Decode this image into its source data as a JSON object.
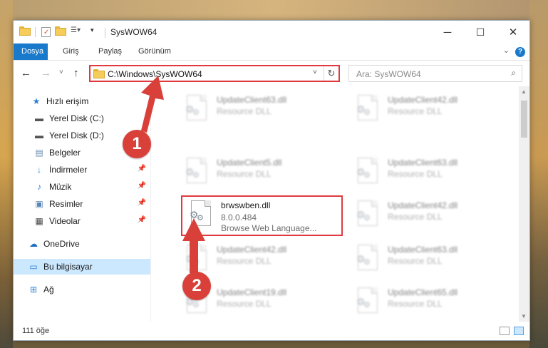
{
  "window": {
    "title": "SysWOW64"
  },
  "window_controls": {
    "minimize": "─",
    "maximize": "☐",
    "close": "✕"
  },
  "ribbon": {
    "tabs": [
      "Dosya",
      "Giriş",
      "Paylaş",
      "Görünüm"
    ],
    "active_tab": "Dosya",
    "help": "?"
  },
  "nav": {
    "back": "←",
    "forward": "→",
    "recent": "˅",
    "up": "↑"
  },
  "address": {
    "path": "C:\\Windows\\SysWOW64",
    "dropdown": "˅",
    "refresh": "↻"
  },
  "search": {
    "placeholder": "Ara: SysWOW64"
  },
  "sidebar": {
    "items": [
      {
        "label": "Hızlı erişim",
        "icon": "star-icon"
      },
      {
        "label": "Yerel Disk (C:)",
        "icon": "drive-icon"
      },
      {
        "label": "Yerel Disk (D:)",
        "icon": "drive-icon"
      },
      {
        "label": "Belgeler",
        "icon": "documents-icon"
      },
      {
        "label": "İndirmeler",
        "icon": "download-icon",
        "pinned": true
      },
      {
        "label": "Müzik",
        "icon": "music-icon",
        "pinned": true
      },
      {
        "label": "Resimler",
        "icon": "pictures-icon",
        "pinned": true
      },
      {
        "label": "Videolar",
        "icon": "video-icon",
        "pinned": true
      },
      {
        "label": "OneDrive",
        "icon": "cloud-icon"
      },
      {
        "label": "Bu bilgisayar",
        "icon": "computer-icon",
        "selected": true
      },
      {
        "label": "Ağ",
        "icon": "network-icon"
      }
    ]
  },
  "files": [
    {
      "name": "UpdateClient63.dll",
      "desc": "Resource DLL",
      "blurred": true
    },
    {
      "name": "UpdateClient42.dll",
      "desc": "Resource DLL",
      "blurred": true
    },
    {
      "name": "UpdateClient5.dll",
      "desc": "Resource DLL",
      "blurred": true
    },
    {
      "name": "UpdateClient63.dll",
      "desc": "Resource DLL",
      "blurred": true
    },
    {
      "name": "brwswben.dll",
      "version": "8.0.0.484",
      "desc": "Browse Web Language...",
      "blurred": false
    },
    {
      "name": "UpdateClient42.dll",
      "desc": "Resource DLL",
      "blurred": true
    },
    {
      "name": "UpdateClient42.dll",
      "desc": "Resource DLL",
      "blurred": true
    },
    {
      "name": "UpdateClient63.dll",
      "desc": "Resource DLL",
      "blurred": true
    },
    {
      "name": "UpdateClient19.dll",
      "desc": "Resource DLL",
      "blurred": true
    },
    {
      "name": "UpdateClient65.dll",
      "desc": "Resource DLL",
      "blurred": true
    }
  ],
  "status": {
    "count": "111 öğe"
  },
  "annotations": {
    "step1": "1",
    "step2": "2",
    "color": "#d9403a"
  }
}
